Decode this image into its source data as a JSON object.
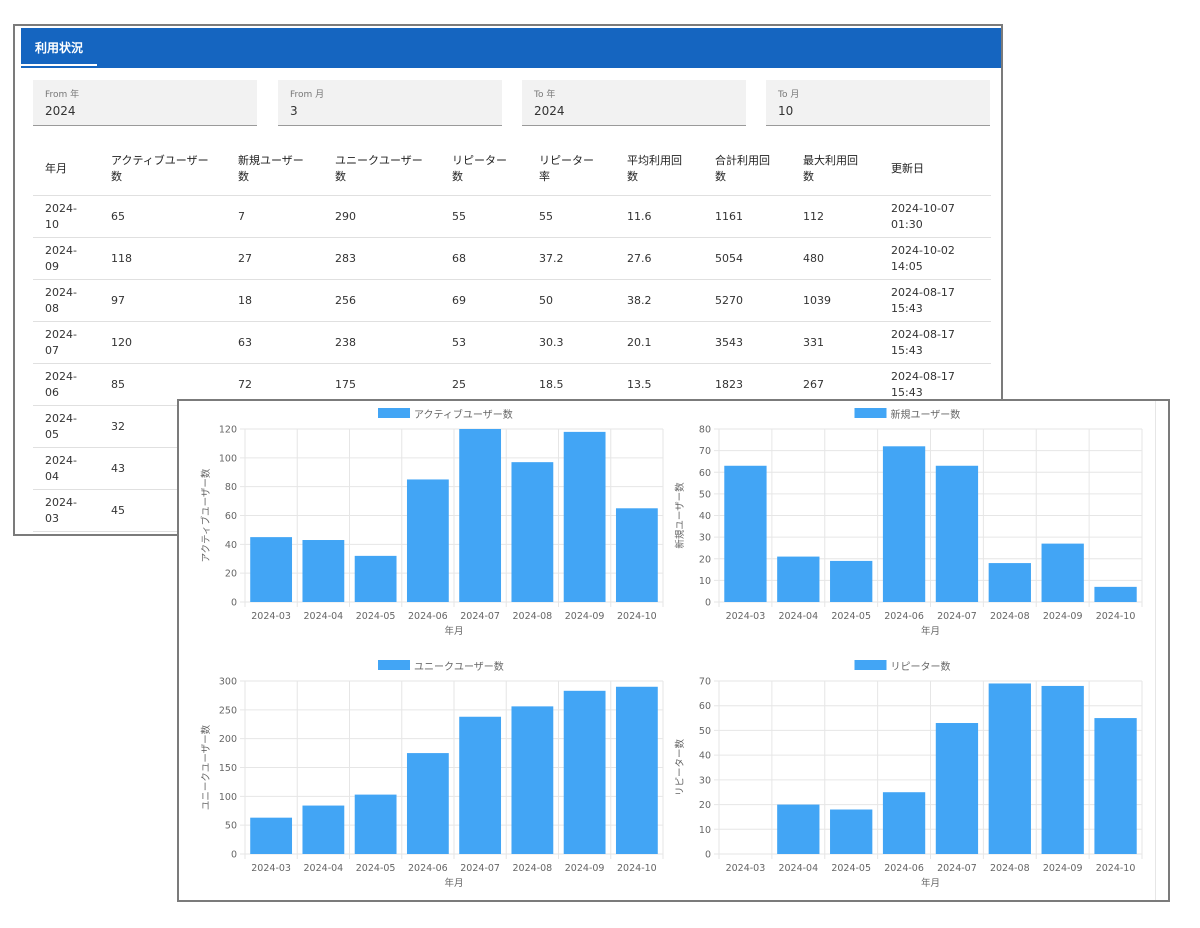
{
  "header": {
    "tab_label": "利用状況"
  },
  "filters": [
    {
      "label": "From 年",
      "value": "2024"
    },
    {
      "label": "From 月",
      "value": "3"
    },
    {
      "label": "To 年",
      "value": "2024"
    },
    {
      "label": "To 月",
      "value": "10"
    }
  ],
  "table": {
    "headers": [
      "年月",
      "アクティブユーザー数",
      "新規ユーザー数",
      "ユニークユーザー数",
      "リピーター数",
      "リピーター率",
      "平均利用回数",
      "合計利用回数",
      "最大利用回数",
      "更新日"
    ],
    "rows": [
      [
        "2024-10",
        "65",
        "7",
        "290",
        "55",
        "55",
        "11.6",
        "1161",
        "112",
        "2024-10-07 01:30"
      ],
      [
        "2024-09",
        "118",
        "27",
        "283",
        "68",
        "37.2",
        "27.6",
        "5054",
        "480",
        "2024-10-02 14:05"
      ],
      [
        "2024-08",
        "97",
        "18",
        "256",
        "69",
        "50",
        "38.2",
        "5270",
        "1039",
        "2024-08-17 15:43"
      ],
      [
        "2024-07",
        "120",
        "63",
        "238",
        "53",
        "30.3",
        "20.1",
        "3543",
        "331",
        "2024-08-17 15:43"
      ],
      [
        "2024-06",
        "85",
        "72",
        "175",
        "25",
        "18.5",
        "13.5",
        "1823",
        "267",
        "2024-08-17 15:43"
      ],
      [
        "2024-05",
        "32"
      ],
      [
        "2024-04",
        "43"
      ],
      [
        "2024-03",
        "45"
      ]
    ]
  },
  "chart_data": [
    {
      "type": "bar",
      "legend": "アクティブユーザー数",
      "xlabel": "年月",
      "ylabel": "アクティブユーザー数",
      "categories": [
        "2024-03",
        "2024-04",
        "2024-05",
        "2024-06",
        "2024-07",
        "2024-08",
        "2024-09",
        "2024-10"
      ],
      "values": [
        45,
        43,
        32,
        85,
        120,
        97,
        118,
        65
      ],
      "ylim": [
        0,
        120
      ],
      "yticks": [
        0,
        20,
        40,
        60,
        80,
        100,
        120
      ],
      "legend_position": "top",
      "grid": true,
      "color": "#42a5f5"
    },
    {
      "type": "bar",
      "legend": "新規ユーザー数",
      "xlabel": "年月",
      "ylabel": "新規ユーザー数",
      "categories": [
        "2024-03",
        "2024-04",
        "2024-05",
        "2024-06",
        "2024-07",
        "2024-08",
        "2024-09",
        "2024-10"
      ],
      "values": [
        63,
        21,
        19,
        72,
        63,
        18,
        27,
        7
      ],
      "ylim": [
        0,
        80
      ],
      "yticks": [
        0,
        10,
        20,
        30,
        40,
        50,
        60,
        70,
        80
      ],
      "legend_position": "top",
      "grid": true,
      "color": "#42a5f5"
    },
    {
      "type": "bar",
      "legend": "ユニークユーザー数",
      "xlabel": "年月",
      "ylabel": "ユニークユーザー数",
      "categories": [
        "2024-03",
        "2024-04",
        "2024-05",
        "2024-06",
        "2024-07",
        "2024-08",
        "2024-09",
        "2024-10"
      ],
      "values": [
        63,
        84,
        103,
        175,
        238,
        256,
        283,
        290
      ],
      "ylim": [
        0,
        300
      ],
      "yticks": [
        0,
        50,
        100,
        150,
        200,
        250,
        300
      ],
      "legend_position": "top",
      "grid": true,
      "color": "#42a5f5"
    },
    {
      "type": "bar",
      "legend": "リピーター数",
      "xlabel": "年月",
      "ylabel": "リピーター数",
      "categories": [
        "2024-03",
        "2024-04",
        "2024-05",
        "2024-06",
        "2024-07",
        "2024-08",
        "2024-09",
        "2024-10"
      ],
      "values": [
        0,
        20,
        18,
        25,
        53,
        69,
        68,
        55
      ],
      "ylim": [
        0,
        70
      ],
      "yticks": [
        0,
        10,
        20,
        30,
        40,
        50,
        60,
        70
      ],
      "legend_position": "top",
      "grid": true,
      "color": "#42a5f5"
    }
  ]
}
